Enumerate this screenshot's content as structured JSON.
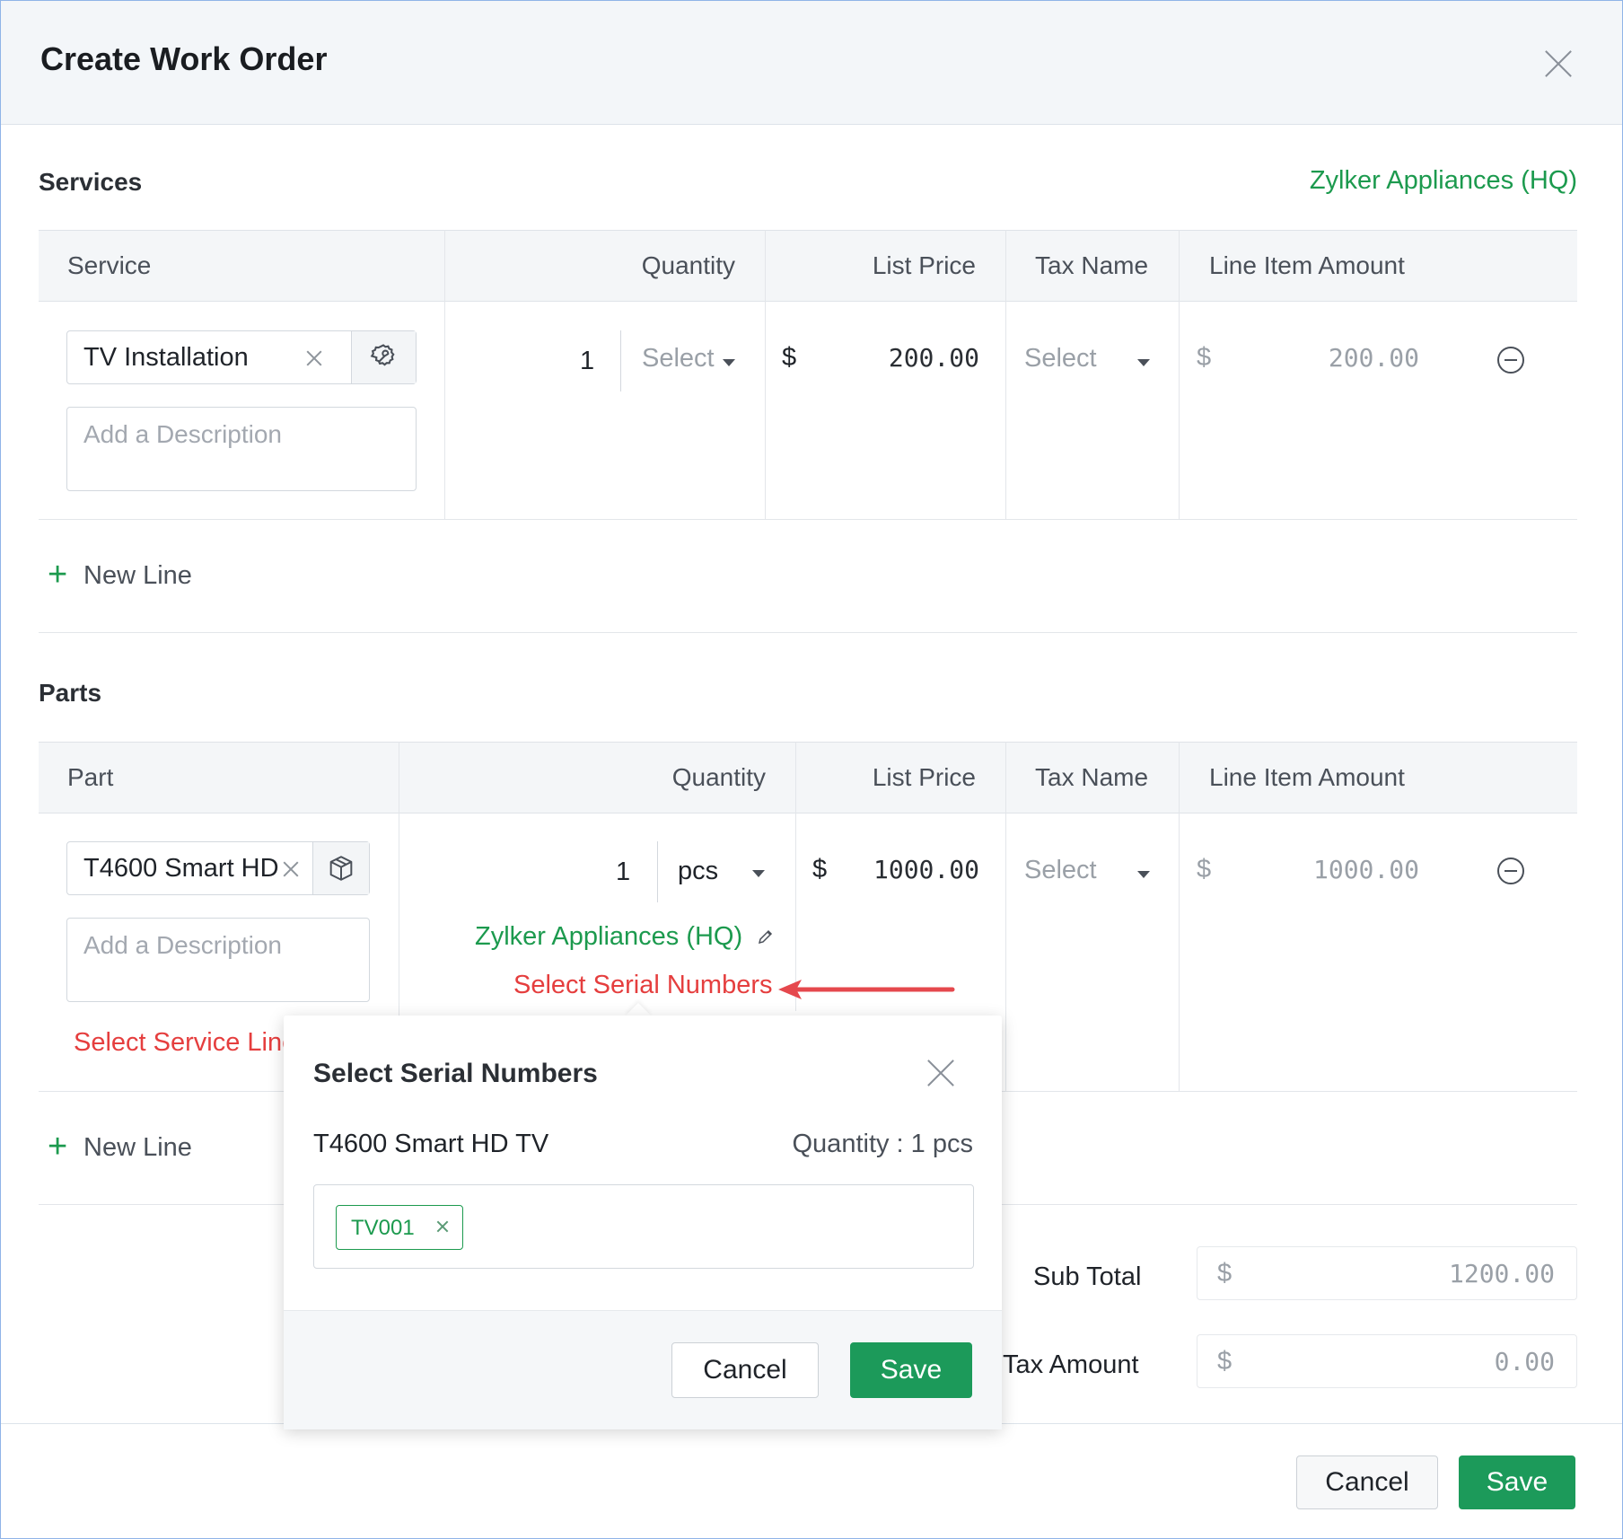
{
  "dialog": {
    "title": "Create Work Order"
  },
  "services": {
    "heading": "Services",
    "warehouse": "Zylker Appliances (HQ)",
    "columns": [
      "Service",
      "Quantity",
      "List Price",
      "Tax Name",
      "Line Item Amount"
    ],
    "row": {
      "name": "TV Installation",
      "description_placeholder": "Add a Description",
      "quantity": "1",
      "unit": "Select",
      "currency": "$",
      "list_price": "200.00",
      "tax": "Select",
      "amount_currency": "$",
      "amount": "200.00"
    },
    "new_line": "New Line"
  },
  "parts": {
    "heading": "Parts",
    "columns": [
      "Part",
      "Quantity",
      "List Price",
      "Tax Name",
      "Line Item Amount"
    ],
    "row": {
      "name": "T4600 Smart HD",
      "description_placeholder": "Add a Description",
      "quantity": "1",
      "unit": "pcs",
      "currency": "$",
      "list_price": "1000.00",
      "tax": "Select",
      "amount_currency": "$",
      "amount": "1000.00",
      "warehouse": "Zylker Appliances (HQ)",
      "select_serial": "Select Serial Numbers",
      "select_service_line": "Select Service Line"
    },
    "new_line": "New Line"
  },
  "totals": {
    "sub_total_label": "Sub Total",
    "sub_total_currency": "$",
    "sub_total": "1200.00",
    "tax_amount_label": "Tax Amount",
    "tax_currency": "$",
    "tax_amount": "0.00"
  },
  "popup": {
    "title": "Select Serial Numbers",
    "item_name": "T4600 Smart HD TV",
    "quantity": "Quantity : 1 pcs",
    "tags": [
      "TV001"
    ],
    "cancel": "Cancel",
    "save": "Save"
  },
  "footer": {
    "cancel": "Cancel",
    "save": "Save"
  },
  "colors": {
    "accent": "#1c9a5a",
    "warning": "#e53e3e",
    "link": "#1c9a4e"
  }
}
